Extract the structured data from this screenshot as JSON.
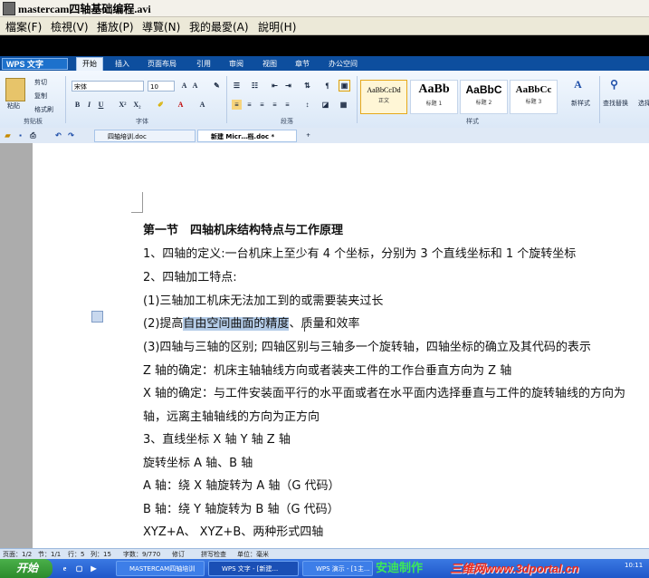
{
  "player": {
    "title": "mastercam四轴基础编程.avi",
    "menu": [
      "檔案(F)",
      "檢視(V)",
      "播放(P)",
      "導覽(N)",
      "我的最愛(A)",
      "說明(H)"
    ]
  },
  "wps": {
    "app_button": "WPS 文字",
    "ribbon_tabs": [
      "开始",
      "插入",
      "页面布局",
      "引用",
      "审阅",
      "视图",
      "章节",
      "办公空间"
    ],
    "active_tab": "开始",
    "clipboard": {
      "paste": "粘贴",
      "cut": "剪切",
      "copy": "复制",
      "format_painter": "格式刷",
      "group": "剪贴板"
    },
    "font": {
      "name": "宋体",
      "size": "10",
      "group": "字体"
    },
    "paragraph_group": "段落",
    "styles": [
      {
        "preview": "AaBbCcDd",
        "name": "正文"
      },
      {
        "preview": "AaBb",
        "name": "标题 1"
      },
      {
        "preview": "AaBbC",
        "name": "标题 2"
      },
      {
        "preview": "AaBbCc",
        "name": "标题 3"
      }
    ],
    "styles_group": "样式",
    "new_style": "新样式",
    "find_replace": "查找替换",
    "select": "选择",
    "doc_tabs": [
      "四轴培训.doc",
      "新建 Micr…档.doc *"
    ]
  },
  "document": {
    "heading": "第一节　四轴机床结构特点与工作原理",
    "lines": [
      "1、四轴的定义:一台机床上至少有 4 个坐标，分别为 3 个直线坐标和 1 个旋转坐标",
      "2、四轴加工特点:",
      "(1)三轴加工机床无法加工到的或需要装夹过长",
      "(3)四轴与三轴的区别; 四轴区别与三轴多一个旋转轴，四轴坐标的确立及其代码的表示",
      "Z 轴的确定：机床主轴轴线方向或者装夹工件的工作台垂直方向为 Z 轴",
      "X 轴的确定：与工件安装面平行的水平面或者在水平面内选择垂直与工件的旋转轴线的方向为",
      "轴，远离主轴轴线的方向为正方向",
      "3、直线坐标 X 轴 Y 轴 Z 轴",
      "旋转坐标 A 轴、B 轴",
      "A 轴：绕 X 轴旋转为 A 轴（G 代码）",
      "B 轴：绕 Y 轴旋转为 B 轴（G 代码）",
      "XYZ+A、  XYZ+B、两种形式四轴"
    ],
    "line2_prefix": "(2)提高",
    "line2_highlight": "自由空间曲面的精度",
    "line2_suffix": "、质量和效率"
  },
  "status": {
    "page": "页面：1/2",
    "section": "节：1/1",
    "row": "行：5",
    "col": "列：15",
    "words": "字数：9/770",
    "revise": "修订",
    "spell": "拼写检查",
    "unit": "单位：毫米"
  },
  "taskbar": {
    "start": "开始",
    "tasks": [
      "MASTERCAM四轴培训",
      "WPS 文字 - [新建...",
      "WPS 演示 - [1主..."
    ],
    "watermark": "安迪制作",
    "site": "三维网www.3dportal.cn",
    "clock": "10:11"
  },
  "colors": {
    "wps_blue": "#0d4e9e",
    "highlight": "#b4cce8",
    "watermark_green": "#3ce85a",
    "site_red": "#e82b1f"
  }
}
